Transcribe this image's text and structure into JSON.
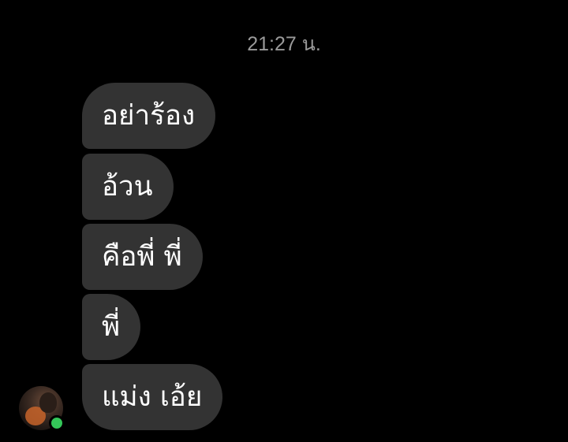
{
  "conversation": {
    "timestamp": "21:27 น.",
    "messages": [
      {
        "text": "อย่าร้อง"
      },
      {
        "text": "อ้วน"
      },
      {
        "text": "คือพี่ พี่"
      },
      {
        "text": "พี่"
      },
      {
        "text": "แม่ง เอ้ย"
      }
    ],
    "sender": {
      "avatar_icon": "user-avatar",
      "online": true,
      "online_color": "#34c759"
    }
  },
  "theme": {
    "background": "#000000",
    "bubble_color": "#333333",
    "text_color": "#ffffff",
    "timestamp_color": "#9a9a9a"
  }
}
